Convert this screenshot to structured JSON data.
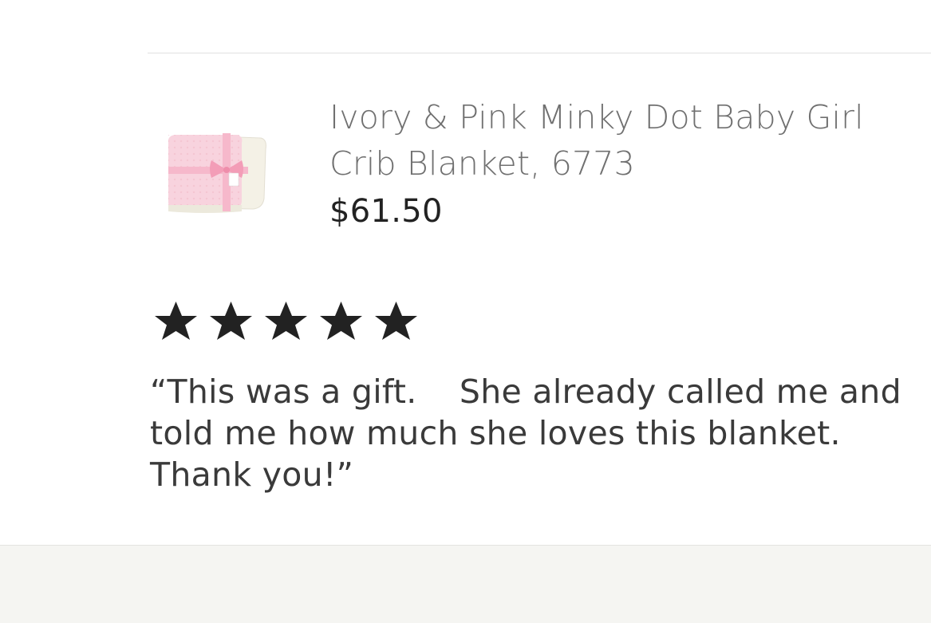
{
  "product": {
    "image_icon": "product-thumbnail-pink-blanket",
    "title": "Ivory & Pink Minky Dot Baby Girl Crib Blanket, 6773",
    "price": "$61.50"
  },
  "review": {
    "rating": 5,
    "rating_max": 5,
    "star_color": "#222222",
    "text": "“This was a gift.    She already called me and told me how much she loves this blanket.  Thank you!”"
  },
  "colors": {
    "background": "#ffffff",
    "divider": "#e1e1e1",
    "footer": "#f5f5f2"
  }
}
